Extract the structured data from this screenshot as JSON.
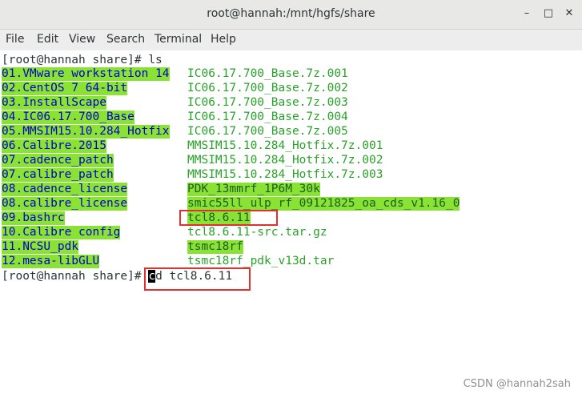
{
  "window": {
    "title": "root@hannah:/mnt/hgfs/share",
    "minimize": "–",
    "maximize": "□",
    "close": "✕"
  },
  "menu": [
    "File",
    "Edit",
    "View",
    "Search",
    "Terminal",
    "Help"
  ],
  "terminal": {
    "prompt1": "[root@hannah share]# ls",
    "left_col": [
      "01.VMware workstation 14",
      "02.CentOS 7 64-bit",
      "03.InstallScape",
      "04.IC06.17.700_Base",
      "05.MMSIM15.10.284_Hotfix",
      "06.Calibre.2015",
      "07.cadence_patch",
      "07.calibre_patch",
      "08.cadence_license",
      "08.calibre_license",
      "09.bashrc",
      "10.Calibre config",
      "11.NCSU_pdk",
      "12.mesa-libGLU"
    ],
    "right_col": [
      "IC06.17.700_Base.7z.001",
      "IC06.17.700_Base.7z.002",
      "IC06.17.700_Base.7z.003",
      "IC06.17.700_Base.7z.004",
      "IC06.17.700_Base.7z.005",
      "MMSIM15.10.284_Hotfix.7z.001",
      "MMSIM15.10.284_Hotfix.7z.002",
      "MMSIM15.10.284_Hotfix.7z.003",
      "PDK_13mmrf_1P6M_30k",
      "smic55ll_ulp_rf_09121825_oa_cds_v1.16_0",
      "tcl8.6.11",
      "tcl8.6.11-src.tar.gz",
      "tsmc18rf",
      "tsmc18rf_pdk_v13d.tar"
    ],
    "prompt2": "[root@hannah share]# ",
    "cursor_char": "c",
    "typed": "d tcl8.6.11"
  },
  "watermark": "CSDN @hannah2sah",
  "colors": {
    "dir_bg": "#8ae234",
    "dir_fg": "#0000cd",
    "archive": "#2aa12a",
    "highlight_box": "#e03030"
  }
}
